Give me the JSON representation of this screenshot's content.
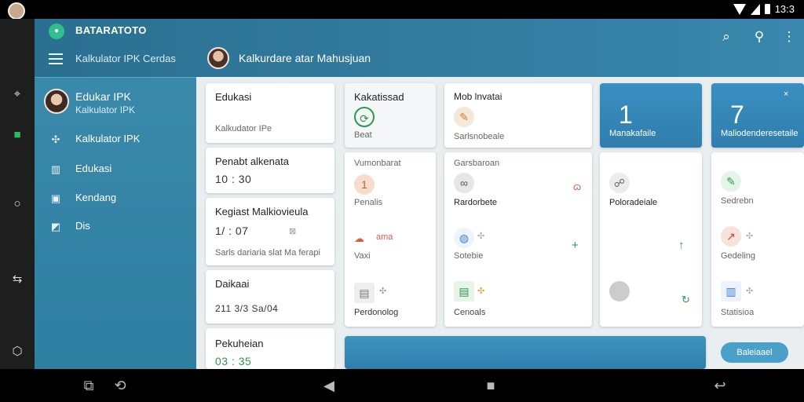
{
  "status": {
    "time": "13:3"
  },
  "app": {
    "brand": "BATARATOTO",
    "subtitle": "Kalkulator IPK Cerdas",
    "header_title": "Kalkurdare atar Mahusjuan",
    "colors": {
      "accent": "#3a89ab",
      "green": "#2fbf8a",
      "red": "#e05a4a"
    }
  },
  "profile": {
    "name": "Edukar IPK",
    "sub": "Kalkulator IPK"
  },
  "drawer": {
    "items": [
      {
        "label": "Kalkulator IPK",
        "icon": "sparkle-icon"
      },
      {
        "label": "Edukasi",
        "icon": "book-icon"
      },
      {
        "label": "Kendang",
        "icon": "image-icon"
      },
      {
        "label": "Dis",
        "icon": "chart-icon"
      }
    ]
  },
  "col1": [
    {
      "title": "Edukasi",
      "sub": "Kalkudator IPe"
    },
    {
      "title": "Penabt alkenata",
      "value": "10 : 30"
    },
    {
      "title": "Kegiast Malkiovieula",
      "value": "1/ : 07",
      "sub": "Sarls dariaria slat Ma ferapi"
    },
    {
      "title": "Daikaai",
      "value": "211 3/3 Sa/04"
    },
    {
      "title": "Pekuheian",
      "value": "03 : 35"
    }
  ],
  "col2": {
    "kakatissad": {
      "title": "Kakatissad",
      "sub": "Beat"
    },
    "vumonbarat": {
      "title": "Vumonbarat",
      "sub": "Penalis"
    },
    "vaxi": {
      "label": "ama",
      "sub": "Vaxi"
    },
    "perdonolog": {
      "sub": "Perdonolog"
    }
  },
  "col3": {
    "mobinvatai": {
      "title": "Mob lnvatai",
      "sub": "Sarlsnobeale"
    },
    "garsbaroan": {
      "title": "Garsbaroan",
      "sub": "Rardorbete"
    },
    "sotebie": {
      "sub": "Sotebie"
    },
    "cenoals": {
      "sub": "Cenoals"
    }
  },
  "col4": {
    "blue1": {
      "value": "1",
      "label": "Manakafaile"
    },
    "poloradeiale": {
      "sub": "Poloradeiale"
    }
  },
  "col5": {
    "blue2": {
      "value": "7",
      "label": "Maliodenderesetaile"
    },
    "sedrebn": {
      "sub": "Sedrebn"
    },
    "gedeling": {
      "sub": "Gedeling"
    },
    "statisioa": {
      "sub": "Statisioa"
    },
    "button": "Baleiaael"
  }
}
